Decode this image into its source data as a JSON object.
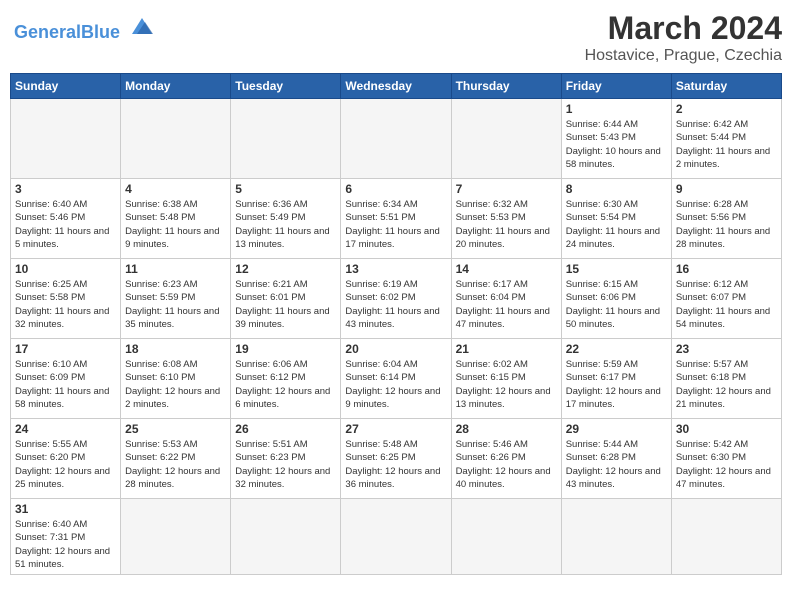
{
  "header": {
    "logo_text_general": "General",
    "logo_text_blue": "Blue",
    "month_title": "March 2024",
    "location": "Hostavice, Prague, Czechia"
  },
  "weekdays": [
    "Sunday",
    "Monday",
    "Tuesday",
    "Wednesday",
    "Thursday",
    "Friday",
    "Saturday"
  ],
  "weeks": [
    [
      {
        "day": "",
        "info": ""
      },
      {
        "day": "",
        "info": ""
      },
      {
        "day": "",
        "info": ""
      },
      {
        "day": "",
        "info": ""
      },
      {
        "day": "",
        "info": ""
      },
      {
        "day": "1",
        "info": "Sunrise: 6:44 AM\nSunset: 5:43 PM\nDaylight: 10 hours and 58 minutes."
      },
      {
        "day": "2",
        "info": "Sunrise: 6:42 AM\nSunset: 5:44 PM\nDaylight: 11 hours and 2 minutes."
      }
    ],
    [
      {
        "day": "3",
        "info": "Sunrise: 6:40 AM\nSunset: 5:46 PM\nDaylight: 11 hours and 5 minutes."
      },
      {
        "day": "4",
        "info": "Sunrise: 6:38 AM\nSunset: 5:48 PM\nDaylight: 11 hours and 9 minutes."
      },
      {
        "day": "5",
        "info": "Sunrise: 6:36 AM\nSunset: 5:49 PM\nDaylight: 11 hours and 13 minutes."
      },
      {
        "day": "6",
        "info": "Sunrise: 6:34 AM\nSunset: 5:51 PM\nDaylight: 11 hours and 17 minutes."
      },
      {
        "day": "7",
        "info": "Sunrise: 6:32 AM\nSunset: 5:53 PM\nDaylight: 11 hours and 20 minutes."
      },
      {
        "day": "8",
        "info": "Sunrise: 6:30 AM\nSunset: 5:54 PM\nDaylight: 11 hours and 24 minutes."
      },
      {
        "day": "9",
        "info": "Sunrise: 6:28 AM\nSunset: 5:56 PM\nDaylight: 11 hours and 28 minutes."
      }
    ],
    [
      {
        "day": "10",
        "info": "Sunrise: 6:25 AM\nSunset: 5:58 PM\nDaylight: 11 hours and 32 minutes."
      },
      {
        "day": "11",
        "info": "Sunrise: 6:23 AM\nSunset: 5:59 PM\nDaylight: 11 hours and 35 minutes."
      },
      {
        "day": "12",
        "info": "Sunrise: 6:21 AM\nSunset: 6:01 PM\nDaylight: 11 hours and 39 minutes."
      },
      {
        "day": "13",
        "info": "Sunrise: 6:19 AM\nSunset: 6:02 PM\nDaylight: 11 hours and 43 minutes."
      },
      {
        "day": "14",
        "info": "Sunrise: 6:17 AM\nSunset: 6:04 PM\nDaylight: 11 hours and 47 minutes."
      },
      {
        "day": "15",
        "info": "Sunrise: 6:15 AM\nSunset: 6:06 PM\nDaylight: 11 hours and 50 minutes."
      },
      {
        "day": "16",
        "info": "Sunrise: 6:12 AM\nSunset: 6:07 PM\nDaylight: 11 hours and 54 minutes."
      }
    ],
    [
      {
        "day": "17",
        "info": "Sunrise: 6:10 AM\nSunset: 6:09 PM\nDaylight: 11 hours and 58 minutes."
      },
      {
        "day": "18",
        "info": "Sunrise: 6:08 AM\nSunset: 6:10 PM\nDaylight: 12 hours and 2 minutes."
      },
      {
        "day": "19",
        "info": "Sunrise: 6:06 AM\nSunset: 6:12 PM\nDaylight: 12 hours and 6 minutes."
      },
      {
        "day": "20",
        "info": "Sunrise: 6:04 AM\nSunset: 6:14 PM\nDaylight: 12 hours and 9 minutes."
      },
      {
        "day": "21",
        "info": "Sunrise: 6:02 AM\nSunset: 6:15 PM\nDaylight: 12 hours and 13 minutes."
      },
      {
        "day": "22",
        "info": "Sunrise: 5:59 AM\nSunset: 6:17 PM\nDaylight: 12 hours and 17 minutes."
      },
      {
        "day": "23",
        "info": "Sunrise: 5:57 AM\nSunset: 6:18 PM\nDaylight: 12 hours and 21 minutes."
      }
    ],
    [
      {
        "day": "24",
        "info": "Sunrise: 5:55 AM\nSunset: 6:20 PM\nDaylight: 12 hours and 25 minutes."
      },
      {
        "day": "25",
        "info": "Sunrise: 5:53 AM\nSunset: 6:22 PM\nDaylight: 12 hours and 28 minutes."
      },
      {
        "day": "26",
        "info": "Sunrise: 5:51 AM\nSunset: 6:23 PM\nDaylight: 12 hours and 32 minutes."
      },
      {
        "day": "27",
        "info": "Sunrise: 5:48 AM\nSunset: 6:25 PM\nDaylight: 12 hours and 36 minutes."
      },
      {
        "day": "28",
        "info": "Sunrise: 5:46 AM\nSunset: 6:26 PM\nDaylight: 12 hours and 40 minutes."
      },
      {
        "day": "29",
        "info": "Sunrise: 5:44 AM\nSunset: 6:28 PM\nDaylight: 12 hours and 43 minutes."
      },
      {
        "day": "30",
        "info": "Sunrise: 5:42 AM\nSunset: 6:30 PM\nDaylight: 12 hours and 47 minutes."
      }
    ],
    [
      {
        "day": "31",
        "info": "Sunrise: 6:40 AM\nSunset: 7:31 PM\nDaylight: 12 hours and 51 minutes."
      },
      {
        "day": "",
        "info": ""
      },
      {
        "day": "",
        "info": ""
      },
      {
        "day": "",
        "info": ""
      },
      {
        "day": "",
        "info": ""
      },
      {
        "day": "",
        "info": ""
      },
      {
        "day": "",
        "info": ""
      }
    ]
  ]
}
